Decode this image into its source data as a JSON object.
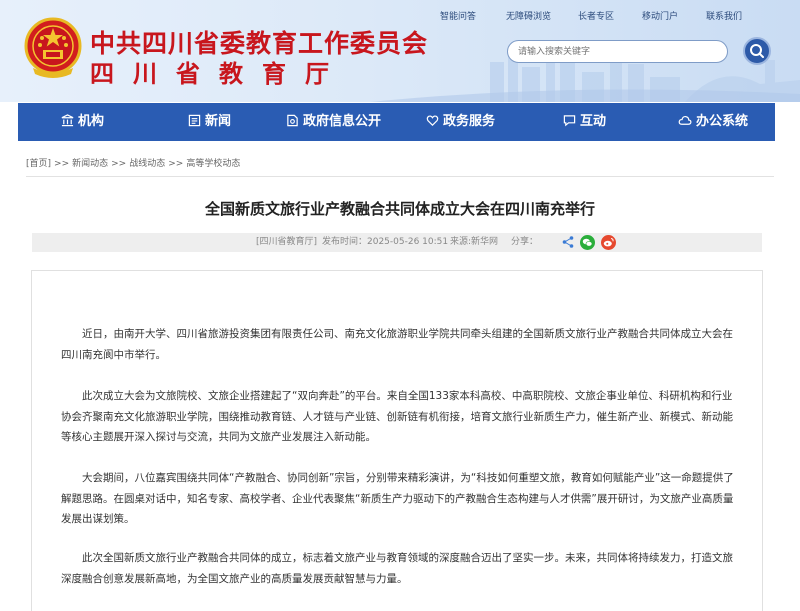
{
  "header": {
    "title": "中共四川省委教育工作委员会",
    "subtitle": "四川省教育厅",
    "top_links": [
      "智能问答",
      "无障碍浏览",
      "长者专区",
      "移动门户",
      "联系我们"
    ],
    "search_placeholder": "请输入搜索关键字"
  },
  "nav": {
    "items": [
      {
        "label": "机构",
        "icon": "building-icon"
      },
      {
        "label": "新闻",
        "icon": "newspaper-icon"
      },
      {
        "label": "政府信息公开",
        "icon": "document-icon"
      },
      {
        "label": "政务服务",
        "icon": "heart-hand-icon"
      },
      {
        "label": "互动",
        "icon": "chat-icon"
      },
      {
        "label": "办公系统",
        "icon": "cloud-icon"
      }
    ],
    "color": "#2a5cb3"
  },
  "breadcrumb": [
    "[首页]",
    "新闻动态",
    "战线动态",
    "高等学校动态"
  ],
  "article": {
    "title": "全国新质文旅行业产教融合共同体成立大会在四川南充举行",
    "source_tag": "[四川省教育厅]",
    "publish_time": "发布时间：2025-05-26 10:51",
    "source": "来源:新华网",
    "share_label": "分享：",
    "paragraphs": [
      "近日，由南开大学、四川省旅游投资集团有限责任公司、南充文化旅游职业学院共同牵头组建的全国新质文旅行业产教融合共同体成立大会在四川南充阆中市举行。",
      "此次成立大会为文旅院校、文旅企业搭建起了“双向奔赴”的平台。来自全国133家本科高校、中高职院校、文旅企事业单位、科研机构和行业协会齐聚南充文化旅游职业学院，围绕推动教育链、人才链与产业链、创新链有机衔接，培育文旅行业新质生产力，催生新产业、新模式、新动能等核心主题展开深入探讨与交流，共同为文旅产业发展注入新动能。",
      "大会期间，八位嘉宾围绕共同体“产教融合、协同创新”宗旨，分别带来精彩演讲，为“科技如何重塑文旅，教育如何赋能产业”这一命题提供了解题思路。在圆桌对话中，知名专家、高校学者、企业代表聚焦“新质生产力驱动下的产教融合生态构建与人才供需”展开研讨，为文旅产业高质量发展出谋划策。",
      "此次全国新质文旅行业产教融合共同体的成立，标志着文旅产业与教育领域的深度融合迈出了坚实一步。未来，共同体将持续发力，打造文旅深度融合创意发展新高地，为全国文旅产业的高质量发展贡献智慧与力量。"
    ]
  }
}
